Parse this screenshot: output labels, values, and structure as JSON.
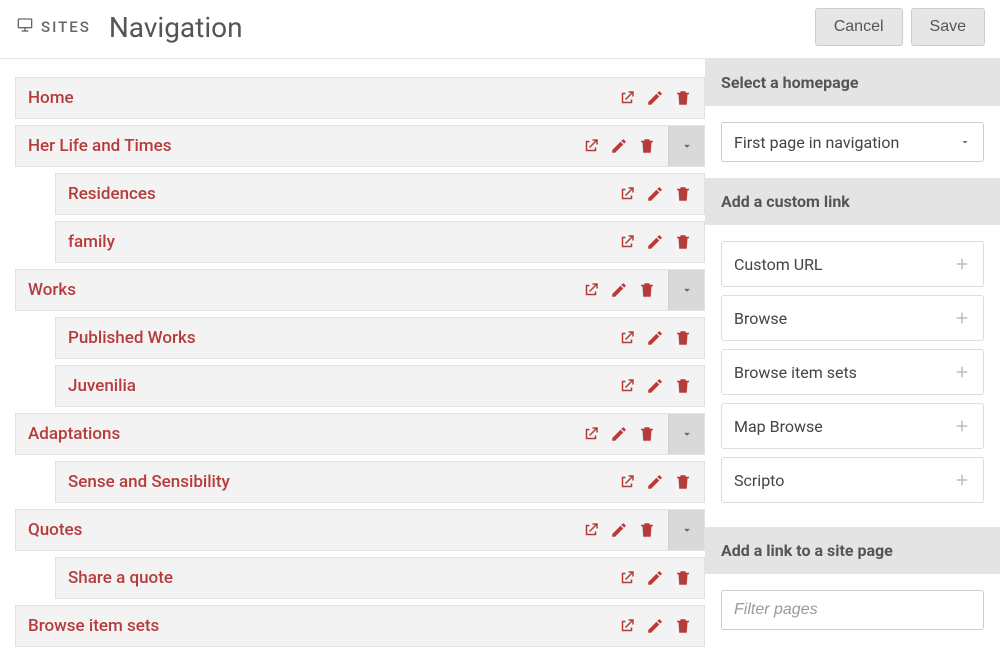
{
  "header": {
    "breadcrumb": "SITES",
    "title": "Navigation",
    "cancel": "Cancel",
    "save": "Save"
  },
  "nav": [
    {
      "label": "Home",
      "indent": 0,
      "toggle": false
    },
    {
      "label": "Her Life and Times",
      "indent": 0,
      "toggle": true
    },
    {
      "label": "Residences",
      "indent": 1,
      "toggle": false
    },
    {
      "label": "family",
      "indent": 1,
      "toggle": false
    },
    {
      "label": "Works",
      "indent": 0,
      "toggle": true
    },
    {
      "label": "Published Works",
      "indent": 1,
      "toggle": false
    },
    {
      "label": "Juvenilia",
      "indent": 1,
      "toggle": false
    },
    {
      "label": "Adaptations",
      "indent": 0,
      "toggle": true
    },
    {
      "label": "Sense and Sensibility",
      "indent": 1,
      "toggle": false
    },
    {
      "label": "Quotes",
      "indent": 0,
      "toggle": true
    },
    {
      "label": "Share a quote",
      "indent": 1,
      "toggle": false
    },
    {
      "label": "Browse item sets",
      "indent": 0,
      "toggle": false
    }
  ],
  "sidebar": {
    "homepage": {
      "heading": "Select a homepage",
      "selected": "First page in navigation"
    },
    "custom_link": {
      "heading": "Add a custom link",
      "options": [
        "Custom URL",
        "Browse",
        "Browse item sets",
        "Map Browse",
        "Scripto"
      ]
    },
    "site_page": {
      "heading": "Add a link to a site page",
      "filter_placeholder": "Filter pages"
    }
  }
}
